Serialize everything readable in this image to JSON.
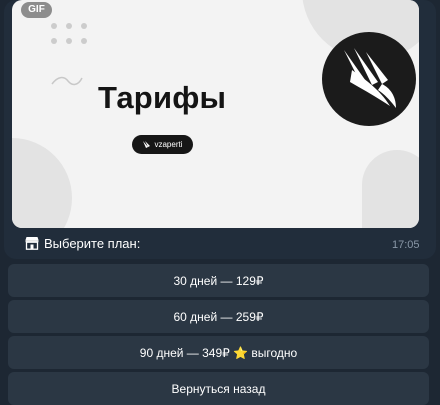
{
  "media": {
    "badge": "GIF",
    "title": "Тарифы",
    "brand": "vzaperti"
  },
  "message": {
    "caption": "Выберите план:",
    "time": "17:05"
  },
  "keyboard": [
    {
      "label": "30 дней — 129₽"
    },
    {
      "label": "60 дней — 259₽"
    },
    {
      "label": "90 дней — 349₽ ⭐ выгодно"
    },
    {
      "label": "Вернуться назад"
    }
  ],
  "colors": {
    "chat_background": "#1d2733",
    "bubble": "#212d3b",
    "button": "#2b3744",
    "timestamp": "#8a98a8"
  }
}
